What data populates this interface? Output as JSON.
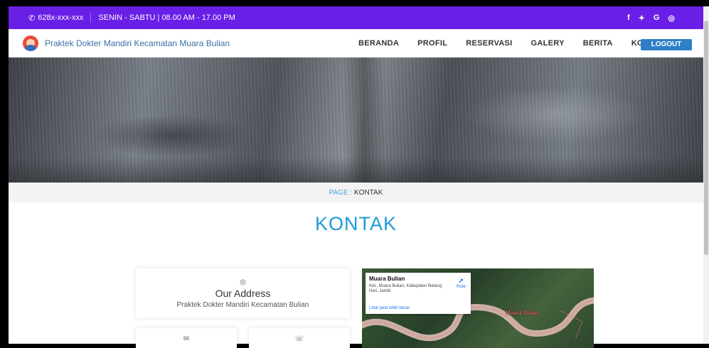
{
  "topbar": {
    "phone": "628x-xxx-xxx",
    "hours": "SENIN - SABTU | 08.00 AM - 17.00 PM",
    "social": [
      "f",
      "y",
      "G",
      "o"
    ]
  },
  "navbar": {
    "brand": "Praktek Dokter Mandiri Kecamatan Muara Bulian",
    "menu": [
      "BERANDA",
      "PROFIL",
      "RESERVASI",
      "GALERY",
      "BERITA",
      "KONTAK"
    ],
    "logout": "LOGOUT"
  },
  "breadcrumb": {
    "prefix": "PAGE",
    "sep": " : ",
    "current": "KONTAK"
  },
  "page_title": "KONTAK",
  "address_card": {
    "title": "Our Address",
    "text": "Praktek Dokter Mandiri Kecamatan Bulian"
  },
  "map": {
    "place_name": "Muara Bulian",
    "place_address": "Kec. Muara Bulian, Kabupaten Batang Hari, Jambi",
    "route_label": "Rute",
    "bigger_map_link": "Lihat peta lebih besar",
    "map_label": "Muara Bulian"
  },
  "colors": {
    "topbar": "#6a1fe6",
    "accent": "#1e9ad6",
    "logout_button": "#2f7fc8"
  }
}
